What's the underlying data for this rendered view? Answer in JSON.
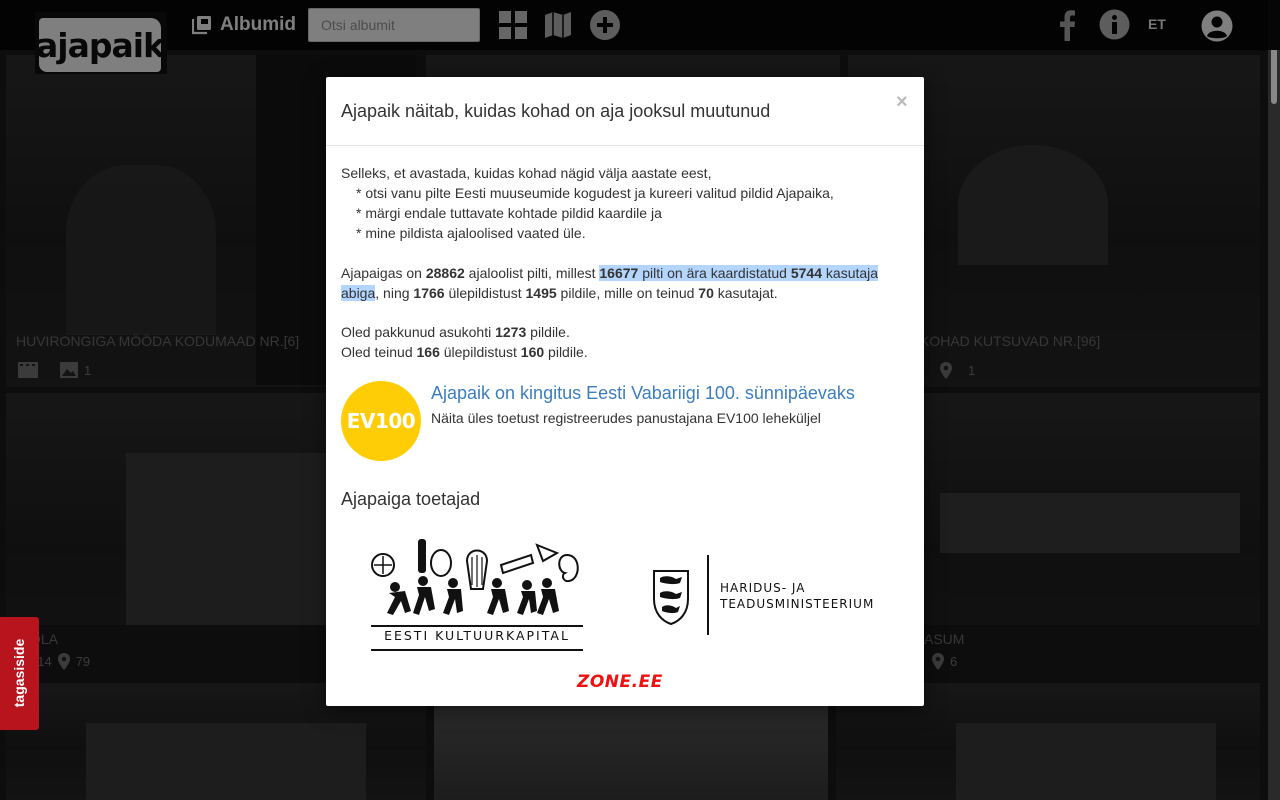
{
  "nav": {
    "logo_text": "ajapaik",
    "albums_label": "Albumid",
    "search_placeholder": "Otsi albumit",
    "language": "ET"
  },
  "tiles": [
    {
      "caption": "HUVIRONGIGA MÖÖDA KODUMAAD NR.[6]",
      "photo_count": "1"
    },
    {
      "caption": "KOHAD KUTSUVAD NR.[96]",
      "location_count": "1"
    },
    {
      "caption": "OLA",
      "photo_count": "514",
      "location_count": "79"
    },
    {
      "caption": "ASUM",
      "location_count": "6"
    }
  ],
  "modal": {
    "title": "Ajapaik näitab, kuidas kohad on aja jooksul muutunud",
    "close": "×",
    "intro": "Selleks, et avastada, kuidas kohad nägid välja aastate eest,",
    "bullets": [
      "* otsi vanu pilte Eesti muuseumide kogudest ja kureeri valitud pildid Ajapaika,",
      "* märgi endale tuttavate kohtade pildid kaardile ja",
      "* mine pildista ajaloolised vaated üle."
    ],
    "stats": {
      "p1": "Ajapaigas on ",
      "total_photos": "28862",
      "p2": " ajaloolist pilti, millest ",
      "geotagged": "16677",
      "p3": " pilti on ära kaardistatud ",
      "helpers": "5744",
      "p4": " kasutaja abiga",
      "p5": ", ning ",
      "rephotos": "1766",
      "p6": " ülepildistust ",
      "rephotographed": "1495",
      "p7": " pildile, mille on teinud ",
      "rephotographers": "70",
      "p8": " kasutajat."
    },
    "user_stats": {
      "l1a": "Oled pakkunud asukohti ",
      "located": "1273",
      "l1b": " pildile.",
      "l2a": "Oled teinud ",
      "my_rephotos": "166",
      "l2b": " ülepildistust ",
      "my_rephotographed": "160",
      "l2c": " pildile."
    },
    "ev100": {
      "badge": "EV100",
      "title": "Ajapaik on kingitus Eesti Vabariigi 100. sünnipäevaks",
      "subtitle": "Näita üles toetust registreerudes panustajana EV100 leheküljel"
    },
    "sponsors_heading": "Ajapaiga toetajad",
    "sponsors": {
      "kulka": "EESTI KULTUURKAPITAL",
      "htm_line1": "Haridus- ja",
      "htm_line2": "Teadusministeerium",
      "zone": "ZONE.EE"
    }
  },
  "feedback_label": "tagasiside"
}
